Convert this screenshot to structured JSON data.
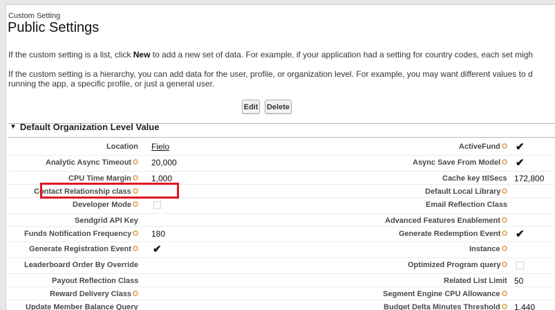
{
  "header": {
    "type_label": "Custom Setting",
    "title": "Public Settings",
    "desc_list_pre": "If the custom setting is a list, click ",
    "desc_list_bold": "New",
    "desc_list_post": " to add a new set of data. For example, if your application had a setting for country codes, each set migh",
    "desc_hier_line1": "If the custom setting is a hierarchy, you can add data for the user, profile, or organization level. For example, you may want different values to d",
    "desc_hier_line2": "running the app, a specific profile, or just a general user."
  },
  "buttons": {
    "edit": "Edit",
    "delete": "Delete"
  },
  "section": {
    "title": "Default Organization Level Value",
    "toggle": "▼"
  },
  "left_fields": [
    {
      "label": "Location",
      "help": false,
      "value": "Fielo",
      "link": true
    },
    {
      "label": "Analytic Async Timeout",
      "help": true,
      "value": "20,000"
    },
    {
      "label": "CPU Time Margin",
      "help": true,
      "value": "1,000"
    },
    {
      "label": "Contact Relationship class",
      "help": true,
      "value": ""
    },
    {
      "label": "Developer Mode",
      "help": true,
      "checkbox": "empty"
    },
    {
      "label": "Sendgrid API Key",
      "help": false,
      "value": ""
    },
    {
      "label": "Funds Notification Frequency",
      "help": true,
      "value": "180"
    },
    {
      "label": "Generate Registration Event",
      "help": true,
      "checkbox": "checked"
    },
    {
      "label": "Leaderboard Order By Override",
      "help": false,
      "value": ""
    },
    {
      "label": "Payout Reflection Class",
      "help": false,
      "value": ""
    },
    {
      "label": "Reward Delivery Class",
      "help": true,
      "value": ""
    },
    {
      "label": "Update Member Balance Query",
      "help": false,
      "value": ""
    }
  ],
  "right_fields": [
    {
      "label": "ActiveFund",
      "help": true,
      "checkbox": "checked"
    },
    {
      "label": "Async Save From Model",
      "help": true,
      "checkbox": "checked"
    },
    {
      "label": "Cache key ttlSecs",
      "help": false,
      "value": "172,800"
    },
    {
      "label": "Default Local Library",
      "help": true,
      "value": ""
    },
    {
      "label": "Email Reflection Class",
      "help": false,
      "value": ""
    },
    {
      "label": "Advanced Features Enablement",
      "help": true,
      "value": ""
    },
    {
      "label": "Generate Redemption Event",
      "help": true,
      "checkbox": "checked"
    },
    {
      "label": "Instance",
      "help": true,
      "value": ""
    },
    {
      "label": "Optimized Program query",
      "help": true,
      "checkbox": "empty"
    },
    {
      "label": "Related List Limit",
      "help": false,
      "value": "50"
    },
    {
      "label": "Segment Engine CPU Allowance",
      "help": true,
      "value": ""
    },
    {
      "label": "Budget Delta Minutes Threshold",
      "help": true,
      "value": "1,440"
    }
  ],
  "check_glyph": "✔",
  "colors": {
    "highlight": "#e0141f",
    "help_icon": "#e0b070"
  }
}
